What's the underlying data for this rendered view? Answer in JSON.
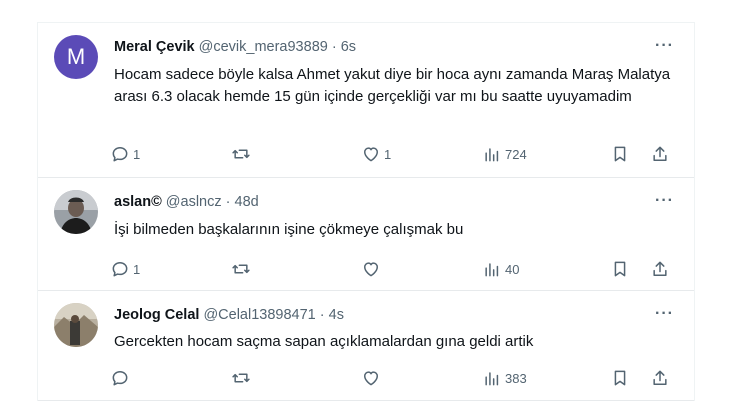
{
  "tweets": [
    {
      "name": "Meral Çevik",
      "handle": "@cevik_mera93889",
      "dot": "·",
      "time": "6s",
      "avatar_letter": "M",
      "avatar_color": "#5b4bb7",
      "text": "Hocam sadece böyle kalsa Ahmet yakut diye bir hoca aynı zamanda Maraş Malatya arası 6.3 olacak hemde 15 gün içinde gerçekliği var mı bu saatte uyuyamadim",
      "replies": "1",
      "retweets": "",
      "likes": "1",
      "views": "724"
    },
    {
      "name": "aslan©",
      "handle": "@aslncz",
      "dot": "·",
      "time": "48d",
      "text": "İşi bilmeden başkalarının işine çökmeye çalışmak bu",
      "replies": "1",
      "retweets": "",
      "likes": "",
      "views": "40"
    },
    {
      "name": "Jeolog Celal",
      "handle": "@Celal13898471",
      "dot": "·",
      "time": "4s",
      "text": "Gercekten hocam saçma sapan açıklamalardan gına geldi artik",
      "replies": "",
      "retweets": "",
      "likes": "",
      "views": "383"
    }
  ],
  "more_label": "···"
}
